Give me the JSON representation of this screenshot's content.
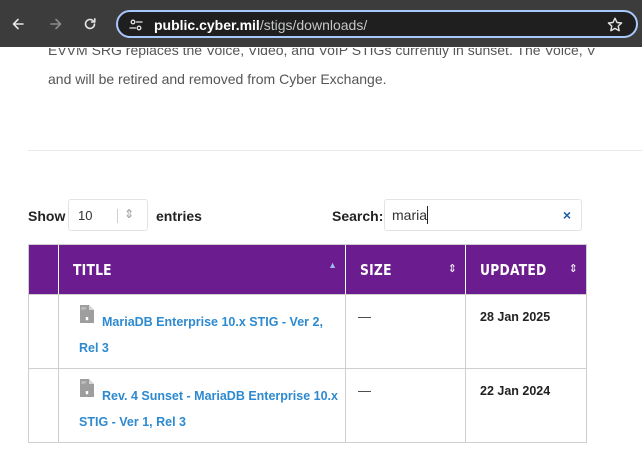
{
  "browser": {
    "url_domain": "public.cyber.mil",
    "url_path": "/stigs/downloads/"
  },
  "content": {
    "cut_line": "EVVM SRG replaces the Voice, Video, and VoIP STIGs currently in sunset. The Voice, V",
    "paragraph_line": "and will be retired and removed from Cyber Exchange."
  },
  "table_controls": {
    "show_label": "Show",
    "length_value": "10",
    "entries_label": "entries",
    "search_label": "Search:",
    "search_value": "maria",
    "clear_glyph": "×"
  },
  "table": {
    "columns": [
      {
        "label": "TITLE",
        "sort": "asc"
      },
      {
        "label": "SIZE",
        "sort": "both"
      },
      {
        "label": "UPDATED",
        "sort": "both"
      }
    ],
    "rows": [
      {
        "title": "MariaDB Enterprise 10.x STIG - Ver 2, Rel 3",
        "size": "—",
        "updated": "28 Jan 2025"
      },
      {
        "title": "Rev. 4 Sunset - MariaDB Enterprise 10.x STIG - Ver 1, Rel 3",
        "size": "—",
        "updated": "22 Jan 2024"
      }
    ]
  },
  "colors": {
    "header_purple": "#6b1c8f",
    "link_blue": "#2d8ad0",
    "browser_bar": "#3c3c3c"
  }
}
